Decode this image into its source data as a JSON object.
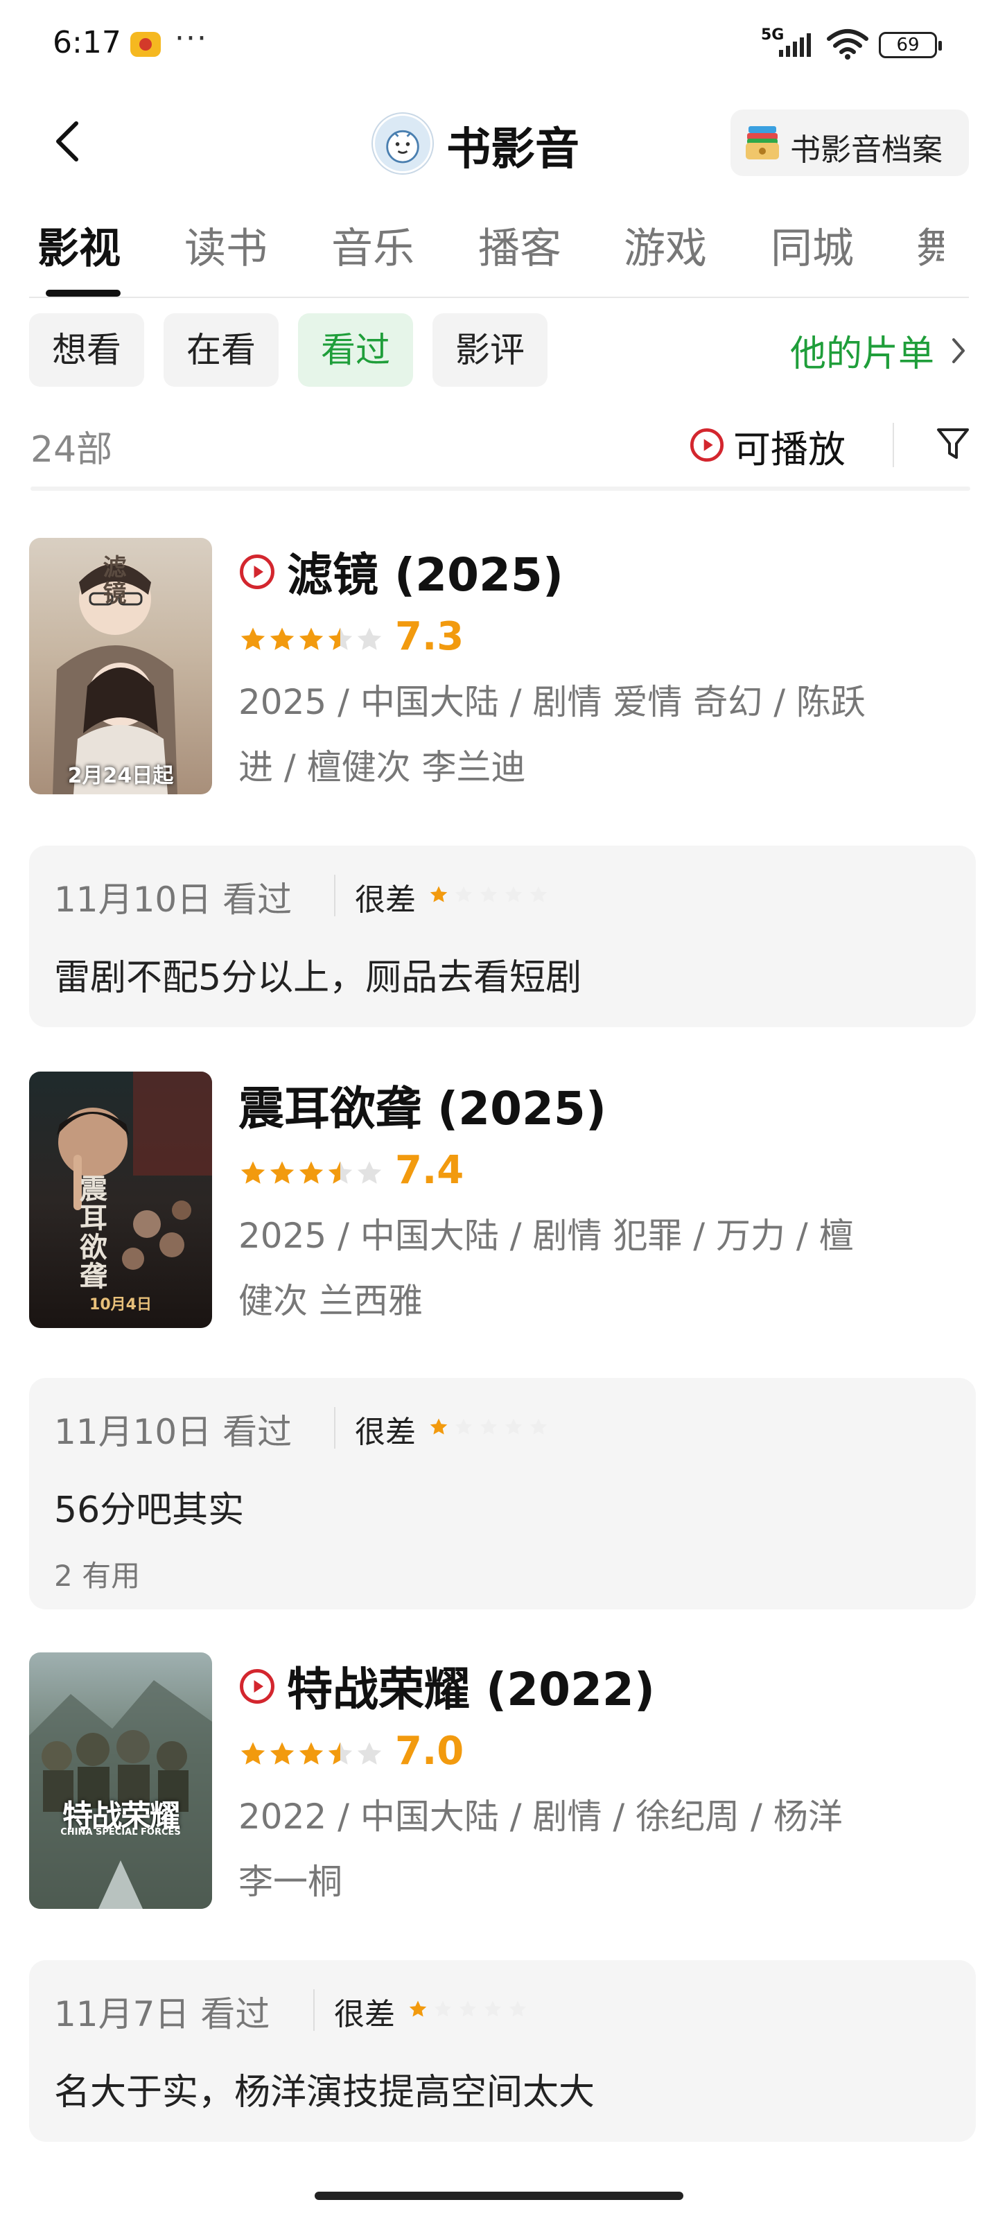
{
  "status_bar": {
    "time": "6:17",
    "dots": "···",
    "network": "5G",
    "battery": "69"
  },
  "header": {
    "title": "书影音",
    "archive_label": "书影音档案"
  },
  "tabs": [
    {
      "label": "影视"
    },
    {
      "label": "读书"
    },
    {
      "label": "音乐"
    },
    {
      "label": "播客"
    },
    {
      "label": "游戏"
    },
    {
      "label": "同城"
    },
    {
      "label": "舞"
    }
  ],
  "active_tab": "影视",
  "filters": [
    {
      "label": "想看"
    },
    {
      "label": "在看"
    },
    {
      "label": "看过"
    },
    {
      "label": "影评"
    }
  ],
  "active_filter": "看过",
  "his_list_label": "他的片单",
  "count_label": "24部",
  "playable_label": "可播放",
  "colors": {
    "accent_green": "#1f9e3a",
    "rating_orange": "#f29a0e",
    "play_red": "#d3262e"
  },
  "movies": [
    {
      "title": "滤镜 (2025)",
      "rating": "7.3",
      "stars": 3.5,
      "playable": true,
      "meta_line1": "2025 / 中国大陆 / 剧情 爱情 奇幻 / 陈跃",
      "meta_line2": "进 / 檀健次 李兰迪",
      "poster_title": "滤镜",
      "poster_date": "2月24日起",
      "review": {
        "date": "11月10日",
        "status": "看过",
        "level": "很差",
        "user_stars": 1,
        "text": "雷剧不配5分以上，厕品去看短剧"
      }
    },
    {
      "title": "震耳欲聋 (2025)",
      "rating": "7.4",
      "stars": 3.5,
      "playable": false,
      "meta_line1": "2025 / 中国大陆 / 剧情 犯罪 / 万力 / 檀",
      "meta_line2": "健次 兰西雅",
      "poster_title": "震耳欲聋",
      "poster_date": "10月4日",
      "review": {
        "date": "11月10日",
        "status": "看过",
        "level": "很差",
        "user_stars": 1,
        "text": "56分吧其实",
        "useful": "2 有用"
      }
    },
    {
      "title": "特战荣耀 (2022)",
      "rating": "7.0",
      "stars": 3.5,
      "playable": true,
      "meta_line1": "2022 / 中国大陆 / 剧情 / 徐纪周 / 杨洋",
      "meta_line2": "李一桐",
      "poster_title": "特战荣耀",
      "poster_subtitle": "CHINA SPECIAL FORCES",
      "review": {
        "date": "11月7日",
        "status": "看过",
        "level": "很差",
        "user_stars": 1,
        "text": "名大于实，杨洋演技提高空间太大"
      }
    }
  ]
}
